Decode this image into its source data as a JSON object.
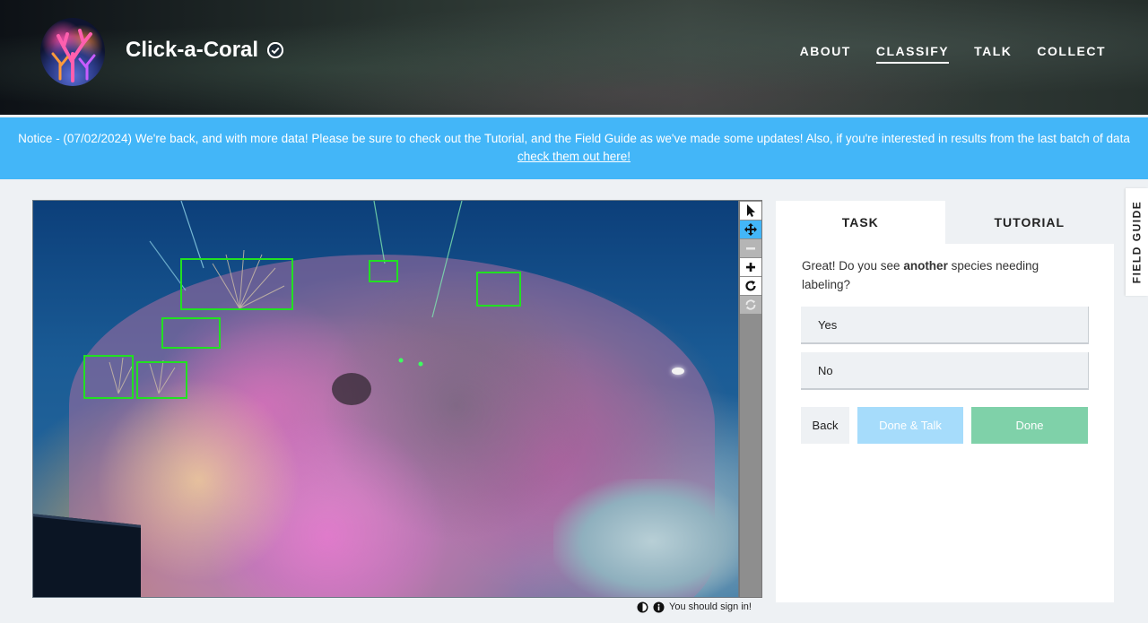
{
  "header": {
    "project_name": "Click-a-Coral",
    "nav": [
      {
        "label": "ABOUT",
        "active": false
      },
      {
        "label": "CLASSIFY",
        "active": true
      },
      {
        "label": "TALK",
        "active": false
      },
      {
        "label": "COLLECT",
        "active": false
      }
    ]
  },
  "notice": {
    "text": "Notice - (07/02/2024) We're back, and with more data! Please be sure to check out the Tutorial, and the Field Guide as we've made some updates! Also, if you're interested in results from the last batch of data ",
    "link_text": "check them out here!"
  },
  "viewer": {
    "toolbar": [
      {
        "name": "pointer-icon",
        "active": false,
        "disabled": false
      },
      {
        "name": "move-icon",
        "active": true,
        "disabled": false
      },
      {
        "name": "zoom-out-icon",
        "active": false,
        "disabled": true
      },
      {
        "name": "zoom-in-icon",
        "active": false,
        "disabled": false
      },
      {
        "name": "rotate-icon",
        "active": false,
        "disabled": false
      },
      {
        "name": "reset-icon",
        "active": false,
        "disabled": true
      }
    ],
    "footer_text": "You should sign in!"
  },
  "task": {
    "tabs": {
      "task": "TASK",
      "tutorial": "TUTORIAL"
    },
    "question_prefix": "Great! Do you see ",
    "question_bold": "another",
    "question_suffix": " species needing labeling?",
    "answers": {
      "yes": "Yes",
      "no": "No"
    },
    "buttons": {
      "back": "Back",
      "done_talk": "Done & Talk",
      "done": "Done"
    }
  },
  "field_guide": {
    "label": "FIELD GUIDE"
  },
  "colors": {
    "notice_bg": "#43b6f8",
    "done_button": "#7fd1a9",
    "done_talk_button": "#a6dcfb",
    "mark_stroke": "#22e022"
  }
}
